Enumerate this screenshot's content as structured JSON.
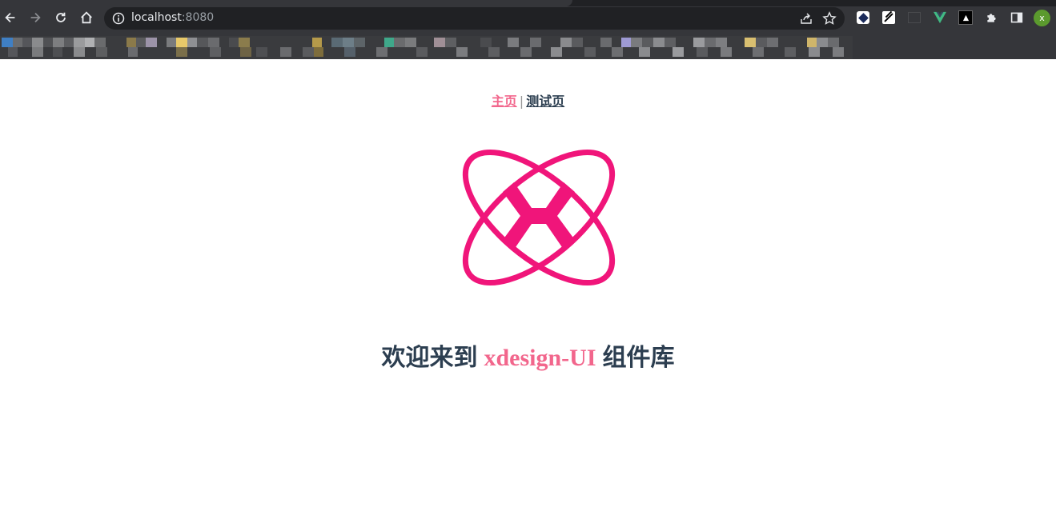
{
  "browser": {
    "url_host": "localhost",
    "url_port": ":8080",
    "profile_initial": "x"
  },
  "nav": {
    "home_label": "主页",
    "separator": "|",
    "test_label": "测试页"
  },
  "welcome": {
    "prefix": "欢迎来到",
    "brand": "xdesign-UI",
    "suffix": "组件库"
  },
  "colors": {
    "accent": "#f2668c",
    "logo": "#f0157a",
    "text": "#2c3e50"
  }
}
